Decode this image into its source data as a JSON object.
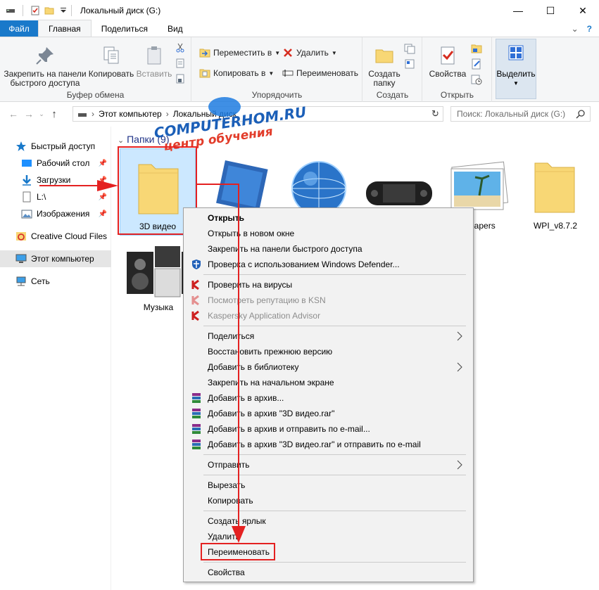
{
  "window": {
    "title": "Локальный диск (G:)"
  },
  "tabs": {
    "file": "Файл",
    "home": "Главная",
    "share": "Поделиться",
    "view": "Вид"
  },
  "ribbon": {
    "clipboard": {
      "label": "Буфер обмена",
      "pin_line1": "Закрепить на панели",
      "pin_line2": "быстрого доступа",
      "copy": "Копировать",
      "paste": "Вставить"
    },
    "organize": {
      "label": "Упорядочить",
      "move_to": "Переместить в",
      "copy_to": "Копировать в",
      "delete": "Удалить",
      "rename": "Переименовать"
    },
    "create": {
      "label": "Создать",
      "new_folder_line1": "Создать",
      "new_folder_line2": "папку"
    },
    "open": {
      "label": "Открыть",
      "properties": "Свойства"
    },
    "select": {
      "label": "Выделить"
    }
  },
  "address": {
    "crumb1": "Этот компьютер",
    "crumb2": "Локальный диск",
    "search_placeholder": "Поиск: Локальный диск (G:)"
  },
  "nav": {
    "items": [
      {
        "label": "Быстрый доступ"
      },
      {
        "label": "Рабочий стол"
      },
      {
        "label": "Загрузки"
      },
      {
        "label": "L:\\"
      },
      {
        "label": "Изображения"
      },
      {
        "label": "Creative Cloud Files"
      },
      {
        "label": "Этот компьютер"
      },
      {
        "label": "Сеть"
      }
    ]
  },
  "content": {
    "group_header": "Папки (9)",
    "tiles": [
      {
        "label": "3D видео"
      },
      {
        "label": "papers"
      },
      {
        "label": "WPI_v8.7.2"
      },
      {
        "label": "Музыка"
      }
    ]
  },
  "context_menu": {
    "items": [
      {
        "label": "Открыть"
      },
      {
        "label": "Открыть в новом окне"
      },
      {
        "label": "Закрепить на панели быстрого доступа"
      },
      {
        "label": "Проверка с использованием Windows Defender..."
      },
      {
        "label": "Проверить на вирусы"
      },
      {
        "label": "Посмотреть репутацию в KSN"
      },
      {
        "label": "Kaspersky Application Advisor"
      },
      {
        "label": "Поделиться"
      },
      {
        "label": "Восстановить прежнюю версию"
      },
      {
        "label": "Добавить в библиотеку"
      },
      {
        "label": "Закрепить на начальном экране"
      },
      {
        "label": "Добавить в архив..."
      },
      {
        "label": "Добавить в архив \"3D видео.rar\""
      },
      {
        "label": "Добавить в архив и отправить по e-mail..."
      },
      {
        "label": "Добавить в архив \"3D видео.rar\" и отправить по e-mail"
      },
      {
        "label": "Отправить"
      },
      {
        "label": "Вырезать"
      },
      {
        "label": "Копировать"
      },
      {
        "label": "Создать ярлык"
      },
      {
        "label": "Удалить"
      },
      {
        "label": "Переименовать"
      },
      {
        "label": "Свойства"
      }
    ]
  },
  "watermark": {
    "line1": "COMPUTERHOM.RU",
    "line2": "центр обучения"
  },
  "colors": {
    "file_tab": "#1979ca",
    "selection": "#cce8ff",
    "annotation": "#e42121",
    "folder": "#f8d775"
  }
}
